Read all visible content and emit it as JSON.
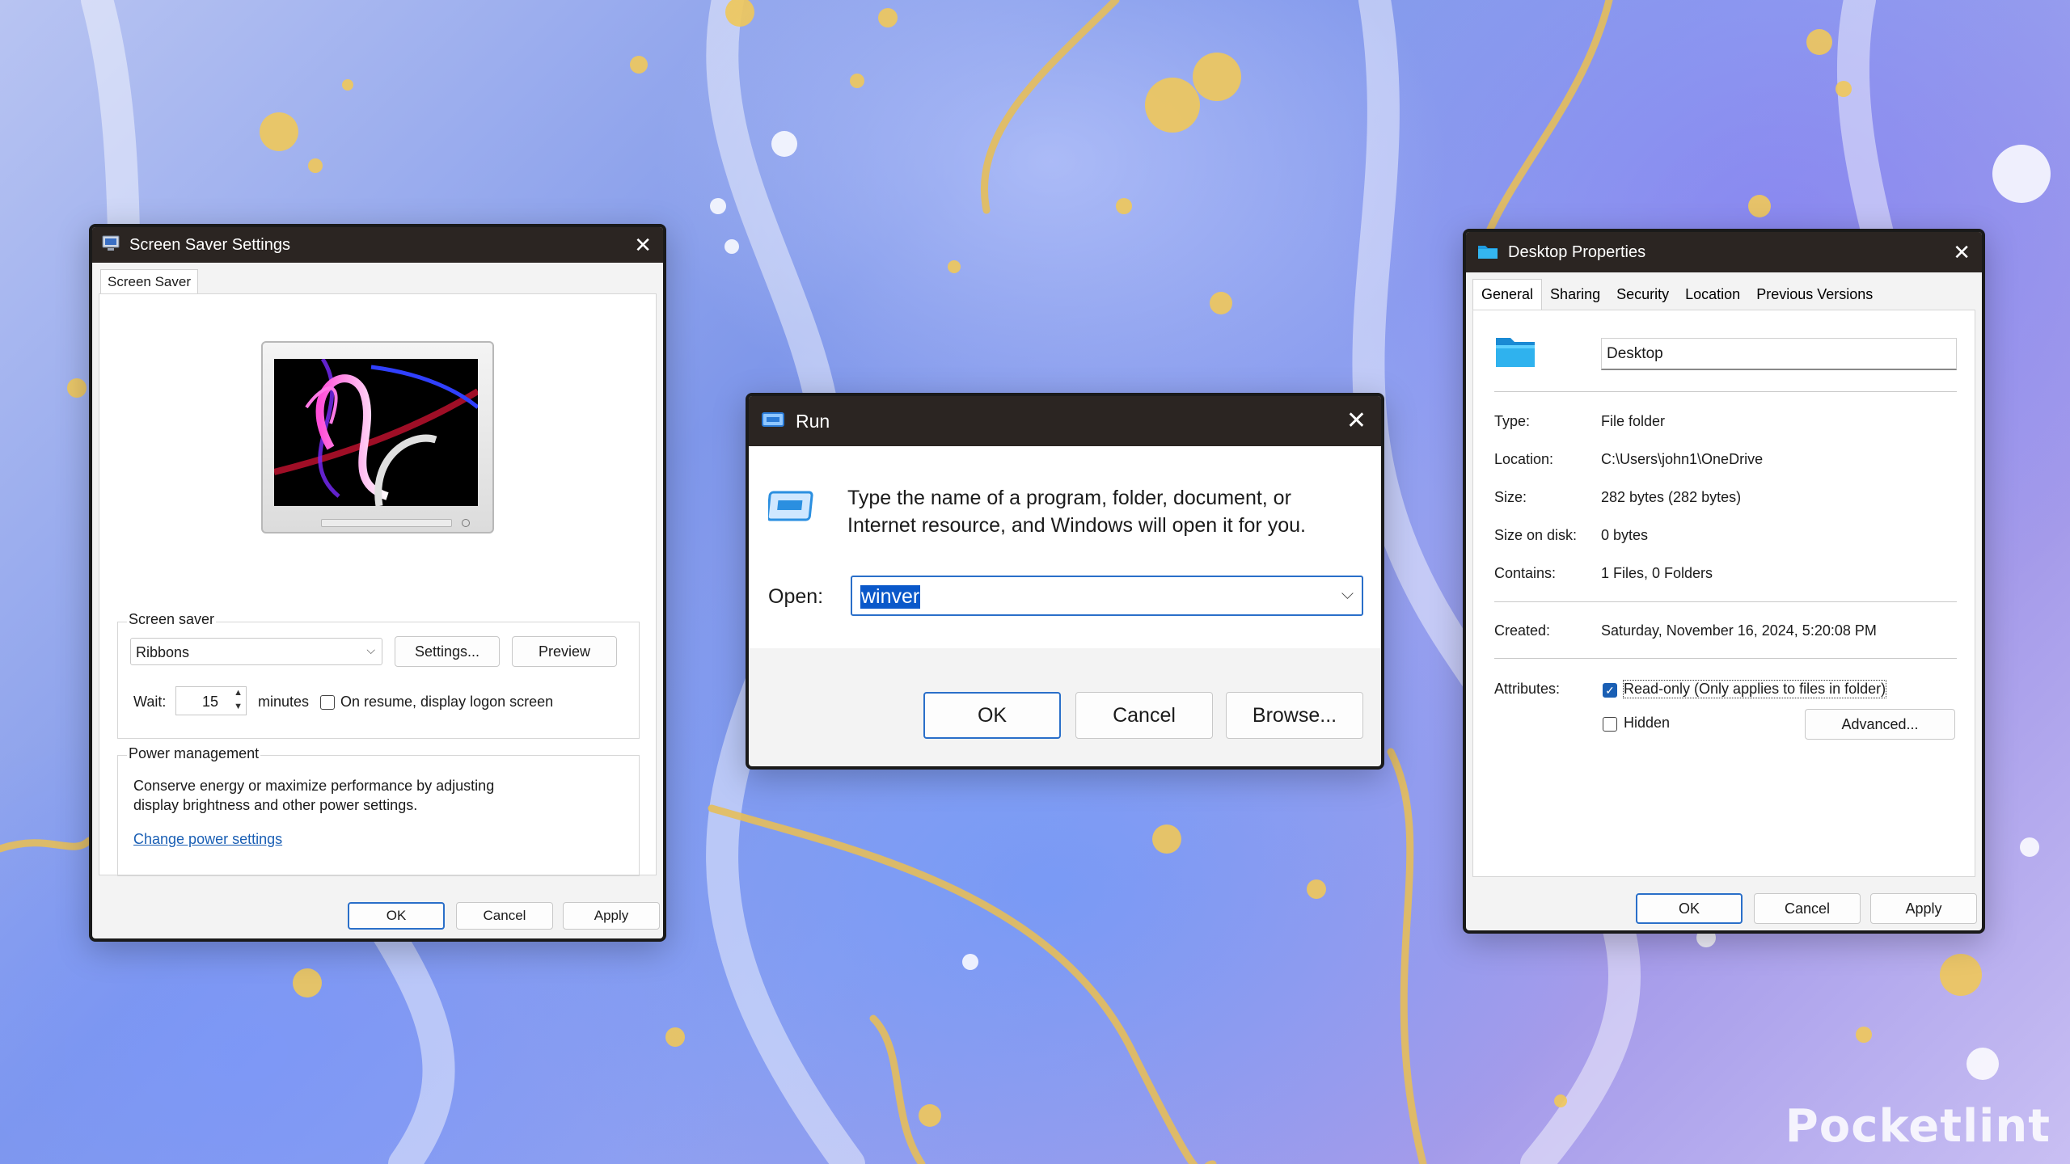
{
  "screen_saver_window": {
    "title": "Screen Saver Settings",
    "tab": "Screen Saver",
    "group_screen_saver": "Screen saver",
    "selected_saver": "Ribbons",
    "settings_button": "Settings...",
    "preview_button": "Preview",
    "wait_label": "Wait:",
    "wait_value": "15",
    "minutes_label": "minutes",
    "resume_label": "On resume, display logon screen",
    "group_power": "Power management",
    "power_text_1": "Conserve energy or maximize performance by adjusting",
    "power_text_2": "display brightness and other power settings.",
    "power_link": "Change power settings",
    "ok": "OK",
    "cancel": "Cancel",
    "apply": "Apply"
  },
  "run_window": {
    "title": "Run",
    "description_1": "Type the name of a program, folder, document, or",
    "description_2": "Internet resource, and Windows will open it for you.",
    "open_label": "Open:",
    "open_value": "winver",
    "ok": "OK",
    "cancel": "Cancel",
    "browse": "Browse..."
  },
  "properties_window": {
    "title": "Desktop Properties",
    "tabs": [
      "General",
      "Sharing",
      "Security",
      "Location",
      "Previous Versions"
    ],
    "folder_name": "Desktop",
    "rows": [
      {
        "label": "Type:",
        "value": "File folder"
      },
      {
        "label": "Location:",
        "value": "C:\\Users\\john1\\OneDrive"
      },
      {
        "label": "Size:",
        "value": "282 bytes (282 bytes)"
      },
      {
        "label": "Size on disk:",
        "value": "0 bytes"
      },
      {
        "label": "Contains:",
        "value": "1 Files, 0 Folders"
      }
    ],
    "created_label": "Created:",
    "created_value": "Saturday, November 16, 2024, 5:20:08 PM",
    "attributes_label": "Attributes:",
    "readonly_label": "Read-only (Only applies to files in folder)",
    "hidden_label": "Hidden",
    "advanced_button": "Advanced...",
    "ok": "OK",
    "cancel": "Cancel",
    "apply": "Apply"
  },
  "watermark": "Pocketlint",
  "colors": {
    "accent": "#1a5fb4",
    "titlebar": "#2b2522",
    "link": "#1a5fb4"
  }
}
